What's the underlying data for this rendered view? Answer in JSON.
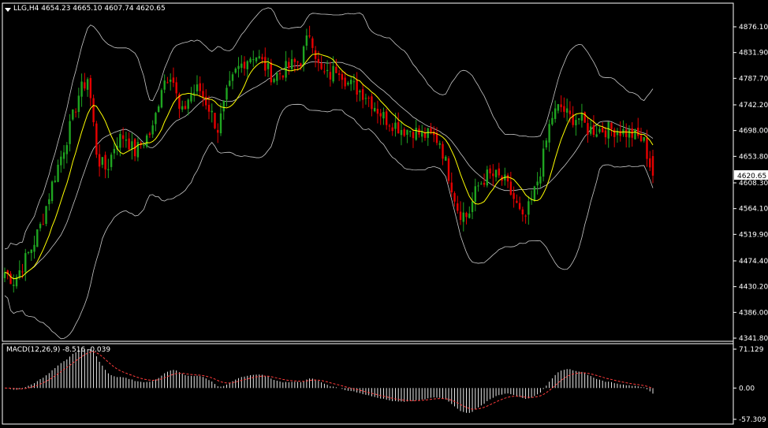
{
  "header": {
    "main_title": "LLG,H4  4654.23 4665.10 4607.74 4620.65",
    "macd_title": "MACD(12,26,9) -8.516 -0.039"
  },
  "current_price_label": "4620.65",
  "colors": {
    "background": "#000000",
    "bull": "#1fa521",
    "bear": "#e60000",
    "ma": "#ffff00",
    "bands": "#c8c8c8",
    "macd_hist": "#ffffff",
    "macd_signal": "#ff3b3b",
    "grid_border": "#ffffff"
  },
  "chart_data": [
    {
      "type": "candlestick",
      "title": "LLG,H4  4654.23 4665.10 4607.74 4620.65",
      "timeframe": "H4",
      "symbol": "LLG",
      "ylim": [
        4341.8,
        4898
      ],
      "y_ticks": [
        "4876.10",
        "4831.90",
        "4787.70",
        "4742.20",
        "4698.00",
        "4653.80",
        "4608.30",
        "4564.10",
        "4519.90",
        "4474.40",
        "4430.20",
        "4386.00",
        "4341.80"
      ],
      "y_tick_values": [
        4876.1,
        4831.9,
        4787.7,
        4742.2,
        4698.0,
        4653.8,
        4608.3,
        4564.1,
        4519.9,
        4474.4,
        4430.2,
        4386.0,
        4341.8
      ],
      "overlays": [
        "moving-average (yellow)",
        "bollinger-bands (gray)"
      ],
      "last": {
        "open": 4654.23,
        "high": 4665.1,
        "low": 4607.74,
        "close": 4620.65
      },
      "close_path": [
        4455,
        4440,
        4470,
        4500,
        4540,
        4600,
        4650,
        4700,
        4760,
        4790,
        4650,
        4630,
        4680,
        4690,
        4660,
        4680,
        4700,
        4780,
        4800,
        4720,
        4760,
        4770,
        4740,
        4700,
        4760,
        4800,
        4820,
        4830,
        4810,
        4790,
        4800,
        4810,
        4820,
        4870,
        4800,
        4790,
        4810,
        4780,
        4770,
        4760,
        4740,
        4720,
        4710,
        4700,
        4700,
        4690,
        4690,
        4680,
        4620,
        4560,
        4550,
        4600,
        4620,
        4620,
        4610,
        4580,
        4540,
        4580,
        4640,
        4720,
        4740,
        4720,
        4720,
        4700,
        4700,
        4700,
        4700,
        4695,
        4690,
        4680,
        4620
      ]
    },
    {
      "type": "bar",
      "title": "MACD(12,26,9) -8.516 -0.039",
      "indicator": "MACD(12,26,9)",
      "macd": -8.516,
      "signal": -0.039,
      "y_ticks": [
        "71.129",
        "0.00",
        "-57.309"
      ],
      "y_tick_values": [
        71.129,
        0.0,
        -57.309
      ],
      "ylim": [
        -57.309,
        71.129
      ]
    }
  ]
}
